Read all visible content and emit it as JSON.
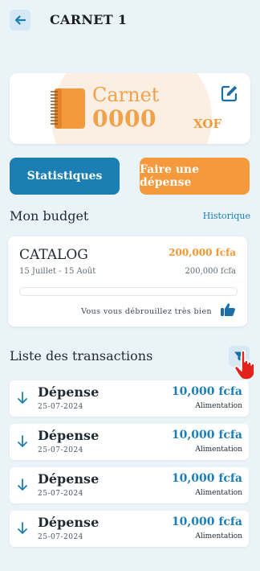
{
  "header": {
    "title": "CARNET 1",
    "back_icon": "arrow-left-icon"
  },
  "carnet": {
    "label": "Carnet",
    "balance": "0000",
    "currency": "XOF",
    "icon": "notebook-icon",
    "edit_icon": "edit-icon",
    "accent_color": "#f2a14b"
  },
  "actions": {
    "statistics_label": "Statistiques",
    "add_expense_label": "Faire une dépense"
  },
  "budget": {
    "section_title": "Mon budget",
    "history_link": "Historique",
    "name": "CATALOG",
    "amount": "200,000 fcfa",
    "period": "15 Juillet - 15 Août",
    "spent": "200,000 fcfa",
    "progress_fraction": 0,
    "message": "Vous vous débrouillez très bien",
    "thumb_icon": "thumbs-up-icon"
  },
  "transactions": {
    "section_title": "Liste des transactions",
    "filter_icon": "filter-icon",
    "items": [
      {
        "type": "Dépense",
        "date": "25-07-2024",
        "amount": "10,000 fcfa",
        "category": "Alimentation"
      },
      {
        "type": "Dépense",
        "date": "25-07-2024",
        "amount": "10,000 fcfa",
        "category": "Alimentation"
      },
      {
        "type": "Dépense",
        "date": "25-07-2024",
        "amount": "10,000 fcfa",
        "category": "Alimentation"
      },
      {
        "type": "Dépense",
        "date": "25-07-2024",
        "amount": "10,000 fcfa",
        "category": "Alimentation"
      }
    ]
  },
  "colors": {
    "primary": "#1b7fb4",
    "accent": "#f59a3c",
    "background": "#eaf3f8"
  }
}
